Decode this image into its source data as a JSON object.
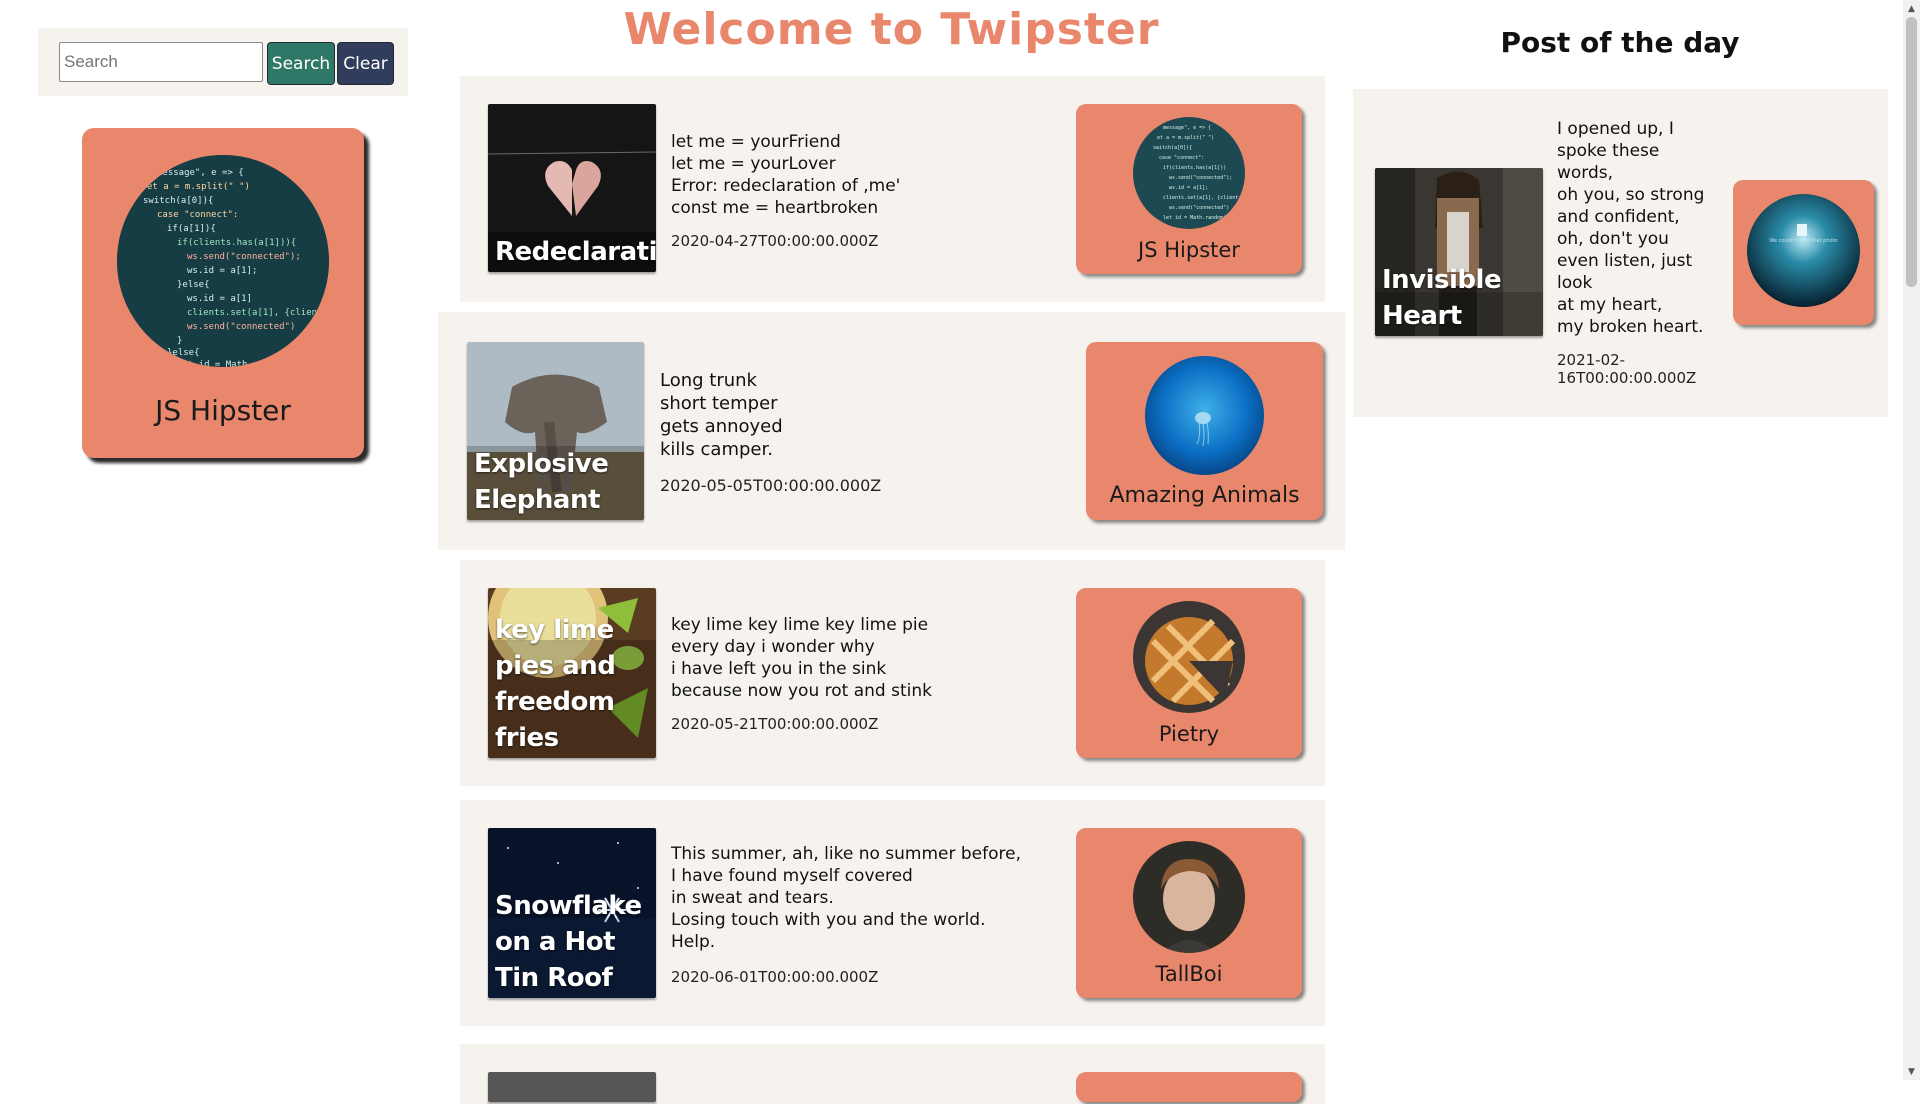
{
  "search": {
    "placeholder": "Search",
    "value": "",
    "search_label": "Search",
    "clear_label": "Clear"
  },
  "profile": {
    "name": "JS Hipster"
  },
  "header": {
    "title": "Welcome to Twipster"
  },
  "posts": [
    {
      "image_title": "Redeclaration",
      "lines": [
        "let me = yourFriend",
        "let me = yourLover",
        "Error: redeclaration of ,me'",
        "const me = heartbroken"
      ],
      "date": "2020-04-27T00:00:00.000Z",
      "author": "JS Hipster"
    },
    {
      "image_title": "Explosive Elephant",
      "lines": [
        "Long trunk",
        "short temper",
        "gets annoyed",
        "kills camper."
      ],
      "date": "2020-05-05T00:00:00.000Z",
      "author": "Amazing Animals"
    },
    {
      "image_title": "key lime pies and freedom fries",
      "lines": [
        "key lime key lime key lime pie",
        "every day i wonder why",
        "i have left you in the sink",
        "because now you rot and stink"
      ],
      "date": "2020-05-21T00:00:00.000Z",
      "author": "Pietry"
    },
    {
      "image_title": "Snowflake on a Hot Tin Roof",
      "lines": [
        "This summer, ah, like no summer before,",
        "I have found myself covered",
        "in sweat and tears.",
        "Losing touch with you and the world.",
        "Help."
      ],
      "date": "2020-06-01T00:00:00.000Z",
      "author": "TallBoi"
    }
  ],
  "post_of_the_day": {
    "heading": "Post of the day",
    "image_title": "Invisible Heart",
    "lines": [
      "I opened up, I",
      "spoke these",
      "words,",
      "oh you, so strong",
      "and confident,",
      "oh, don't you",
      "even listen, just",
      "look",
      "at my heart,",
      "my broken heart."
    ],
    "date_lines": [
      "2021-02-",
      "16T00:00:00.000Z"
    ],
    "avatar_text": "We couldn't find that photo"
  },
  "colors": {
    "accent": "#e9876c",
    "panel": "#f6f3ef",
    "search_button": "#2f7868",
    "clear_button": "#323c5c"
  }
}
